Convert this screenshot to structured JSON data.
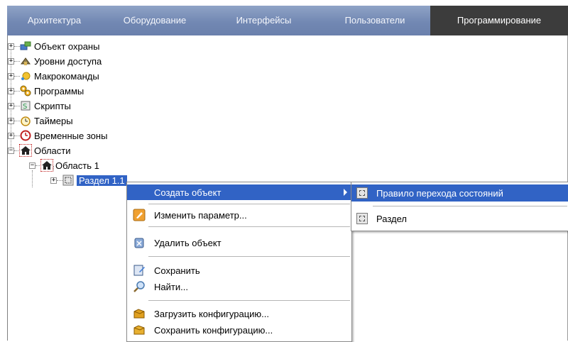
{
  "tabs": [
    {
      "label": "Архитектура"
    },
    {
      "label": "Оборудование"
    },
    {
      "label": "Интерфейсы"
    },
    {
      "label": "Пользователи"
    },
    {
      "label": "Программирование",
      "active": true
    }
  ],
  "tree": {
    "items": [
      {
        "label": "Объект охраны",
        "icon": "security-object-icon"
      },
      {
        "label": "Уровни доступа",
        "icon": "access-levels-icon"
      },
      {
        "label": "Макрокоманды",
        "icon": "macro-commands-icon"
      },
      {
        "label": "Программы",
        "icon": "programs-icon"
      },
      {
        "label": "Скрипты",
        "icon": "scripts-icon"
      },
      {
        "label": "Таймеры",
        "icon": "timers-icon"
      },
      {
        "label": "Временные зоны",
        "icon": "time-zones-icon"
      },
      {
        "label": "Области",
        "icon": "areas-icon"
      },
      {
        "label": "Область 1",
        "icon": "area-icon"
      },
      {
        "label": "Раздел 1.1",
        "icon": "section-icon"
      }
    ]
  },
  "context_menu": {
    "items": [
      {
        "label": "Создать объект",
        "icon": ""
      },
      {
        "label": "Изменить параметр...",
        "icon": "edit-parameter-icon"
      },
      {
        "label": "Удалить объект",
        "icon": "delete-object-icon"
      },
      {
        "label": "Сохранить",
        "icon": "save-icon"
      },
      {
        "label": "Найти...",
        "icon": "find-icon"
      },
      {
        "label": "Загрузить конфигурацию...",
        "icon": "load-config-icon"
      },
      {
        "label": "Сохранить конфигурацию...",
        "icon": "save-config-icon"
      }
    ]
  },
  "submenu": {
    "items": [
      {
        "label": "Правило перехода состояний",
        "icon": "state-transition-rule-icon"
      },
      {
        "label": "Раздел",
        "icon": "section-icon"
      }
    ]
  }
}
